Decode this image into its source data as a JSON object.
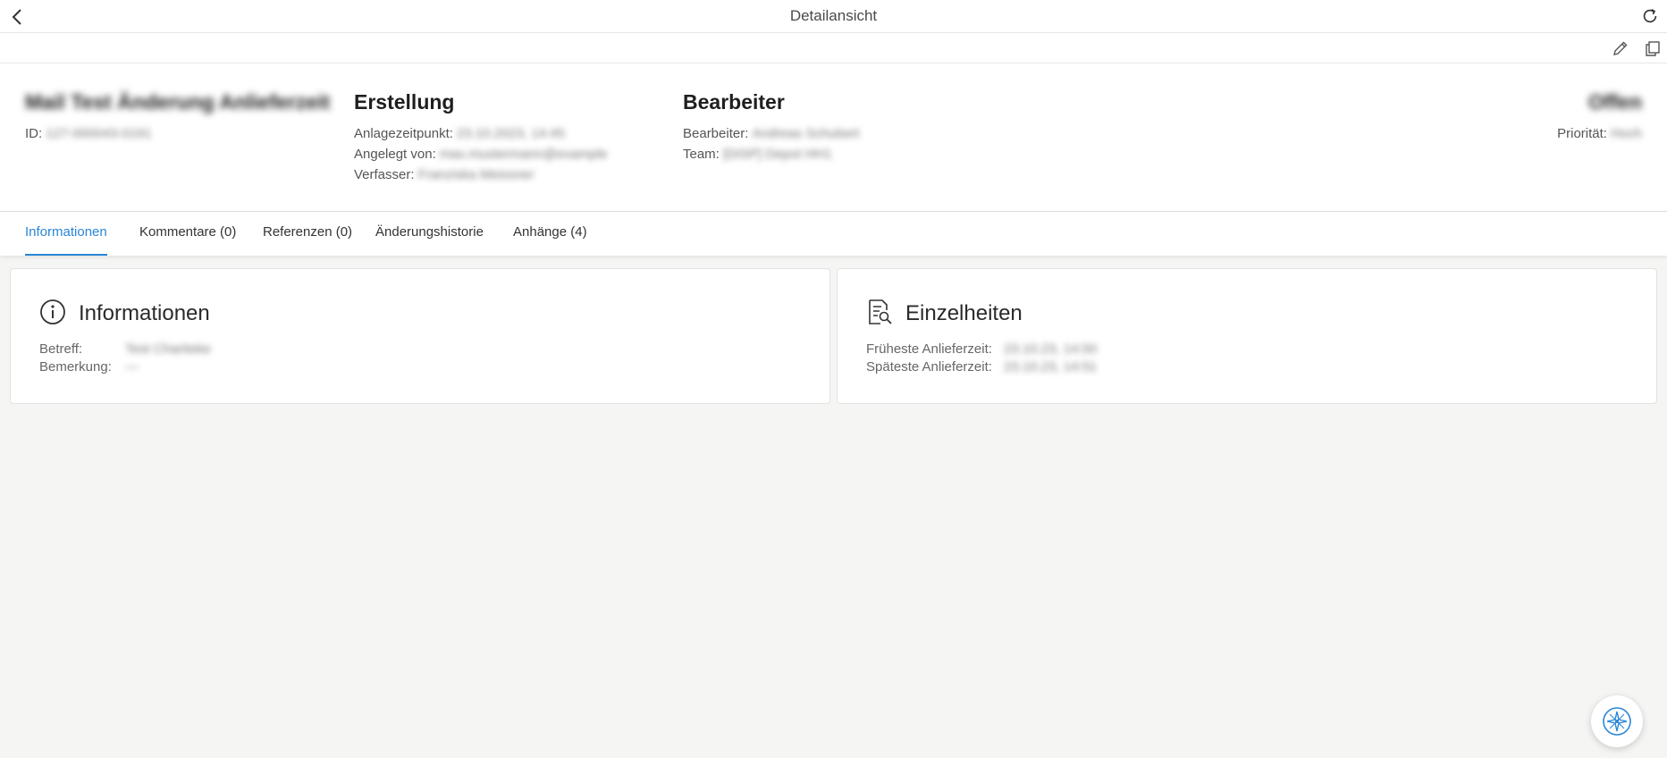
{
  "topbar": {
    "title": "Detailansicht",
    "back_icon": "chevron-left-icon",
    "refresh_icon": "refresh-icon"
  },
  "toolbar": {
    "edit_icon": "pencil-icon",
    "copy_icon": "copy-icon"
  },
  "header": {
    "record_title": "Mail Test Änderung Anlieferzeit",
    "id_label": "ID:",
    "id_value": "127-000043-0191",
    "creation": {
      "heading": "Erstellung",
      "created_at_label": "Anlagezeitpunkt:",
      "created_at_value": "23.10.2023, 14:45",
      "created_by_label": "Angelegt von:",
      "created_by_value": "max.mustermann@example",
      "author_label": "Verfasser:",
      "author_value": "Franziska Meissner"
    },
    "assignee": {
      "heading": "Bearbeiter",
      "assignee_label": "Bearbeiter:",
      "assignee_value": "Andreas Schubert",
      "team_label": "Team:",
      "team_value": "[DISP] Depot HH1"
    },
    "status": "Offen",
    "priority_label": "Priorität:",
    "priority_value": "Hoch"
  },
  "tabs": [
    {
      "label": "Informationen",
      "active": true
    },
    {
      "label": "Kommentare (0)",
      "active": false
    },
    {
      "label": "Referenzen (0)",
      "active": false
    },
    {
      "label": "Änderungshistorie",
      "active": false
    },
    {
      "label": "Anhänge (4)",
      "active": false
    }
  ],
  "info_card": {
    "title": "Informationen",
    "icon": "info-circle-icon",
    "subject_label": "Betreff:",
    "subject_value": "Test Chariteke",
    "remark_label": "Bemerkung:",
    "remark_value": "—"
  },
  "details_card": {
    "title": "Einzelheiten",
    "icon": "document-search-icon",
    "earliest_label": "Früheste Anlieferzeit:",
    "earliest_value": "23.10.23, 14:50",
    "latest_label": "Späteste Anlieferzeit:",
    "latest_value": "23.10.23, 14:51"
  },
  "fab": {
    "icon": "compass-icon"
  },
  "colors": {
    "accent": "#2a86d6",
    "status": "#f25555"
  }
}
